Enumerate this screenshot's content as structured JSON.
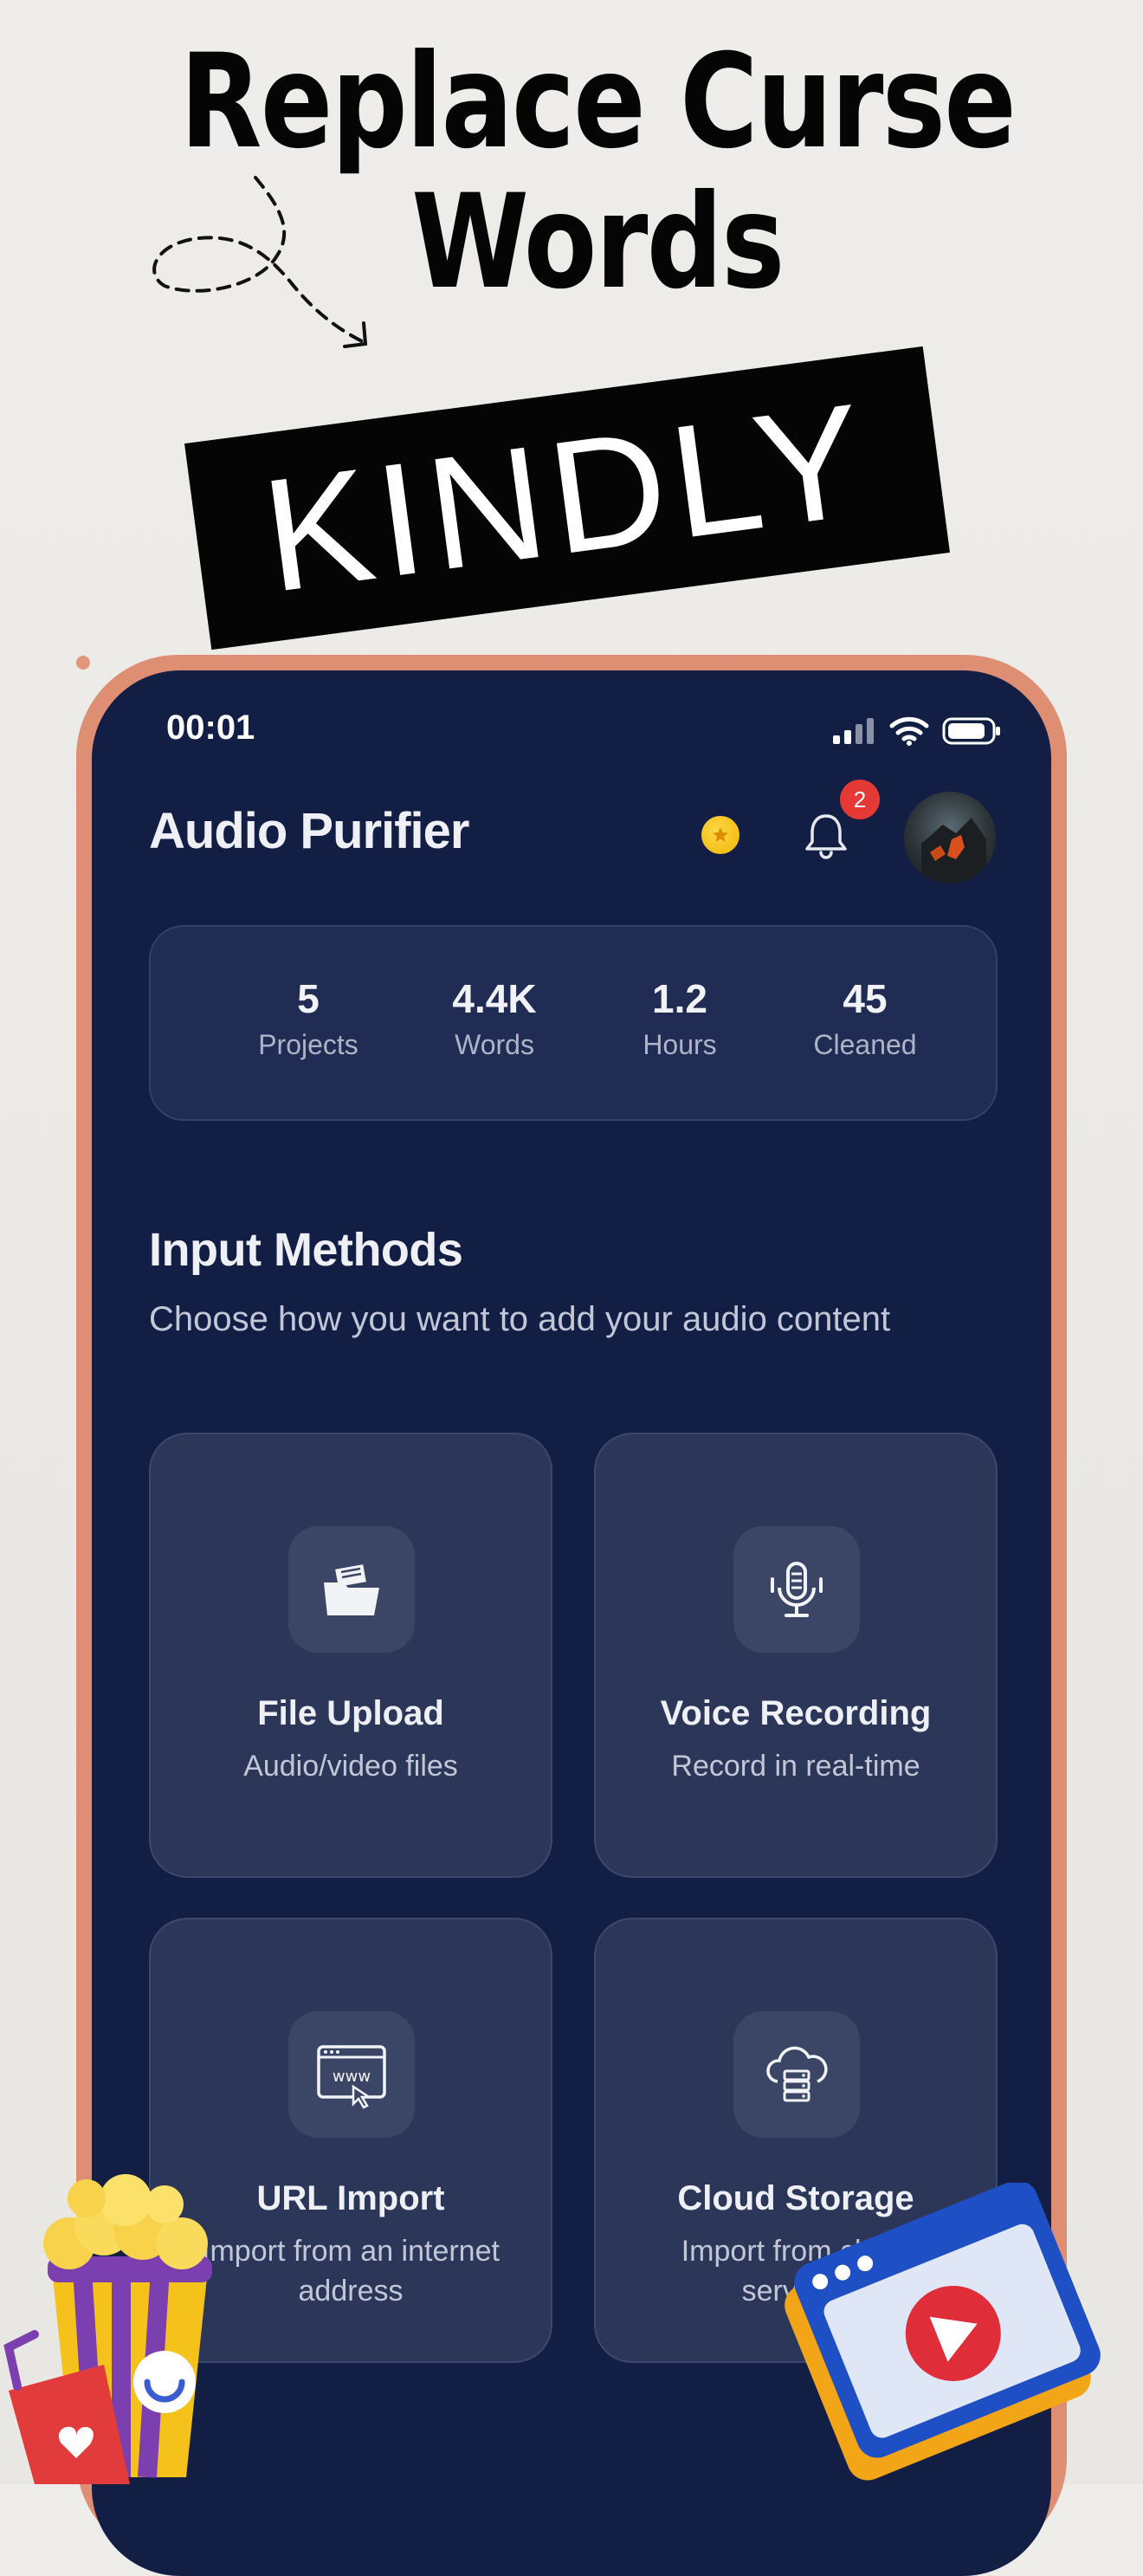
{
  "promo": {
    "headline_line1": "Replace Curse",
    "headline_line2": "Words",
    "highlight": "KINDLY"
  },
  "status_bar": {
    "time": "00:01"
  },
  "header": {
    "title": "Audio Purifier",
    "notification_count": "2"
  },
  "stats": [
    {
      "value": "5",
      "label": "Projects"
    },
    {
      "value": "4.4K",
      "label": "Words"
    },
    {
      "value": "1.2",
      "label": "Hours"
    },
    {
      "value": "45",
      "label": "Cleaned"
    }
  ],
  "input_methods": {
    "title": "Input Methods",
    "subtitle": "Choose how you want to add your audio content",
    "cards": [
      {
        "title": "File Upload",
        "subtitle": "Audio/video files",
        "icon": "folder-icon"
      },
      {
        "title": "Voice Recording",
        "subtitle": "Record in real-time",
        "icon": "microphone-icon"
      },
      {
        "title": "URL Import",
        "subtitle": "Import from an internet address",
        "icon": "www-icon"
      },
      {
        "title": "Cloud Storage",
        "subtitle": "Import from cloud services",
        "icon": "cloud-server-icon"
      }
    ]
  },
  "colors": {
    "screen_bg": "#131e45",
    "card_bg": "#2b3659",
    "frame": "#de8f73",
    "badge": "#e53935",
    "coin": "#f5c518"
  }
}
